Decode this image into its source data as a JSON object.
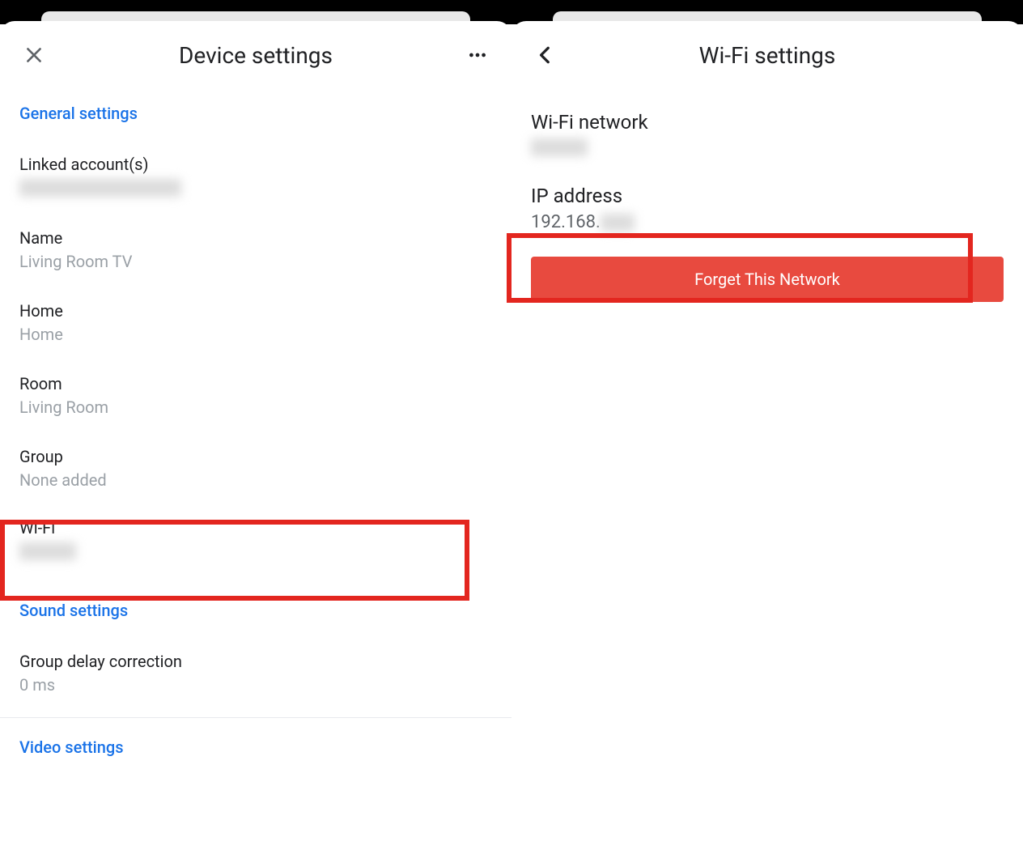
{
  "left": {
    "title": "Device settings",
    "general_link": "General settings",
    "linked_accounts_label": "Linked account(s)",
    "name_label": "Name",
    "name_value": "Living Room TV",
    "home_label": "Home",
    "home_value": "Home",
    "room_label": "Room",
    "room_value": "Living Room",
    "group_label": "Group",
    "group_value": "None added",
    "wifi_label": "Wi-Fi",
    "sound_settings_link": "Sound settings",
    "group_delay_label": "Group delay correction",
    "group_delay_value": "0 ms",
    "video_settings_link": "Video settings"
  },
  "right": {
    "title": "Wi-Fi settings",
    "wifi_network_label": "Wi-Fi network",
    "ip_label": "IP address",
    "ip_value_partial": "192.168.",
    "forget_button": "Forget This Network"
  }
}
